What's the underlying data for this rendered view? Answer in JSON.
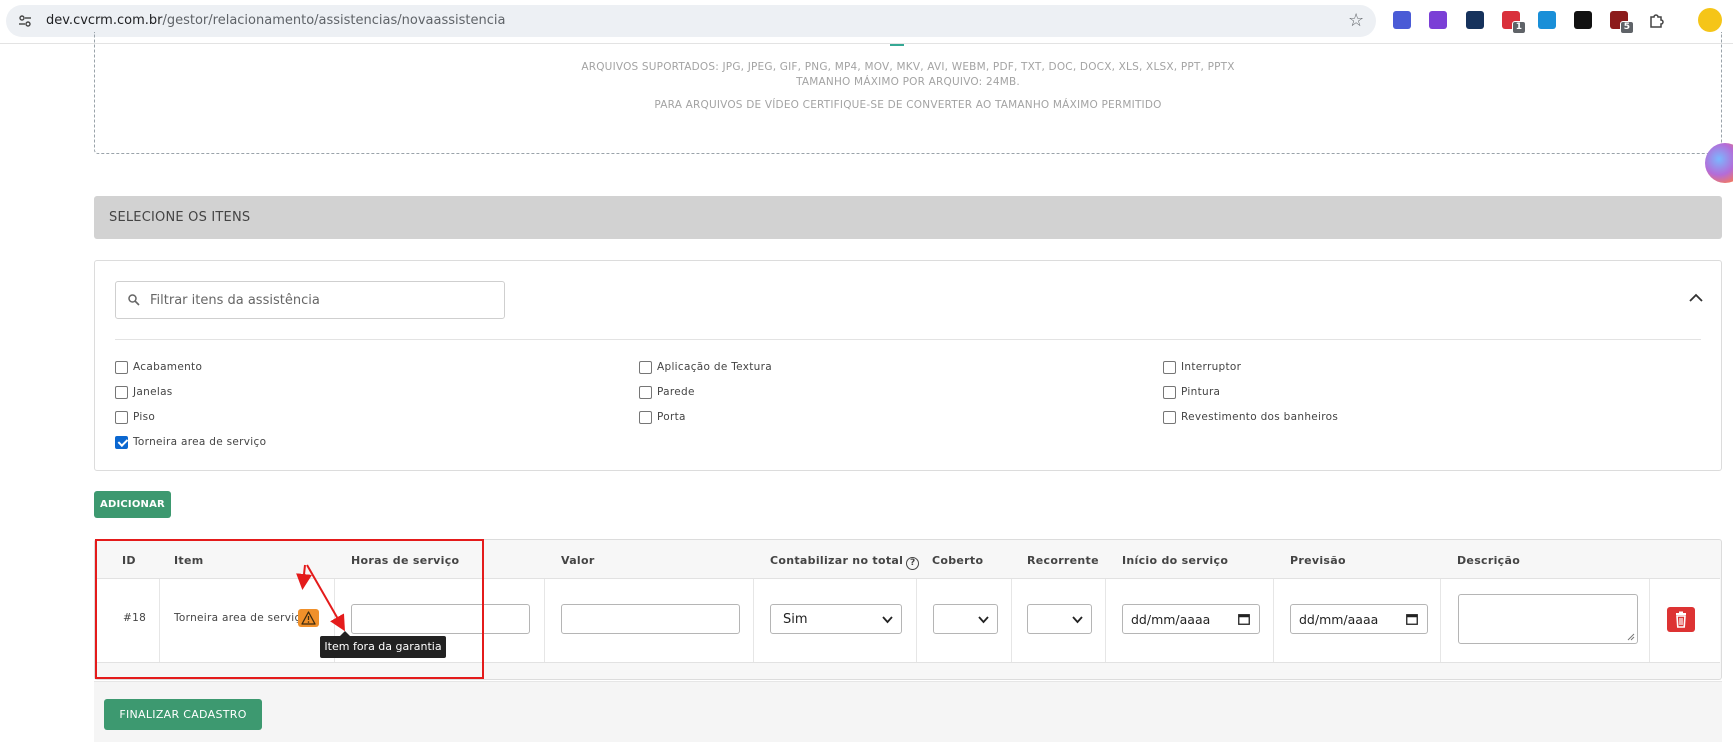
{
  "browser": {
    "url_host": "dev.cvcrm.com.br",
    "url_path": "/gestor/relacionamento/assistencias/novaassistencia",
    "extensions": [
      {
        "icon": "gear-flower-icon",
        "color": "#4a5bd6",
        "badge": ""
      },
      {
        "icon": "feather-icon",
        "color": "#7b3fd6",
        "badge": ""
      },
      {
        "icon": "bird-icon",
        "color": "#16325c",
        "badge": ""
      },
      {
        "icon": "abp-icon",
        "color": "#d9303b",
        "badge": "1"
      },
      {
        "icon": "grid-icon",
        "color": "#1a8fd8",
        "badge": ""
      },
      {
        "icon": "terminal-icon",
        "color": "#111111",
        "badge": ""
      },
      {
        "icon": "shield-icon",
        "color": "#8c1c1c",
        "badge": "5"
      }
    ]
  },
  "upload": {
    "formats_line": "ARQUIVOS SUPORTADOS: JPG, JPEG, GIF, PNG, MP4, MOV, MKV, AVI, WEBM, PDF, TXT, DOC, DOCX, XLS, XLSX, PPT, PPTX",
    "max_size_line": "TAMANHO MÁXIMO POR ARQUIVO: 24MB.",
    "video_note": "PARA ARQUIVOS DE VÍDEO CERTIFIQUE-SE DE CONVERTER AO TAMANHO MÁXIMO PERMITIDO"
  },
  "section": {
    "title": "SELECIONE OS ITENS"
  },
  "filter": {
    "placeholder": "Filtrar itens da assistência",
    "checkboxes": [
      {
        "label": "Acabamento",
        "checked": false
      },
      {
        "label": "Janelas",
        "checked": false
      },
      {
        "label": "Piso",
        "checked": false
      },
      {
        "label": "Torneira area de serviço",
        "checked": true
      },
      {
        "label": "Aplicação de Textura",
        "checked": false
      },
      {
        "label": "Parede",
        "checked": false
      },
      {
        "label": "Porta",
        "checked": false
      },
      {
        "label": "Interruptor",
        "checked": false
      },
      {
        "label": "Pintura",
        "checked": false
      },
      {
        "label": "Revestimento dos banheiros",
        "checked": false
      }
    ]
  },
  "actions": {
    "add_label": "ADICIONAR",
    "finish_label": "FINALIZAR CADASTRO"
  },
  "table": {
    "headers": {
      "id": "ID",
      "item": "Item",
      "hours": "Horas de serviço",
      "value": "Valor",
      "count": "Contabilizar no total",
      "covered": "Coberto",
      "recurring": "Recorrente",
      "start": "Início do serviço",
      "forecast": "Previsão",
      "description": "Descrição"
    },
    "row": {
      "id": "#18",
      "item": "Torneira area de serviço",
      "hours": "",
      "value": "",
      "count": "Sim",
      "covered": "",
      "recurring": "",
      "start": "dd/mm/aaaa",
      "forecast": "dd/mm/aaaa",
      "description": ""
    }
  },
  "tooltip": {
    "text": "Item fora da garantia"
  },
  "colors": {
    "accent_green": "#3d9970",
    "danger_red": "#dd3333",
    "warning_orange": "#f0902a",
    "annotation_red": "#e41b1b"
  }
}
